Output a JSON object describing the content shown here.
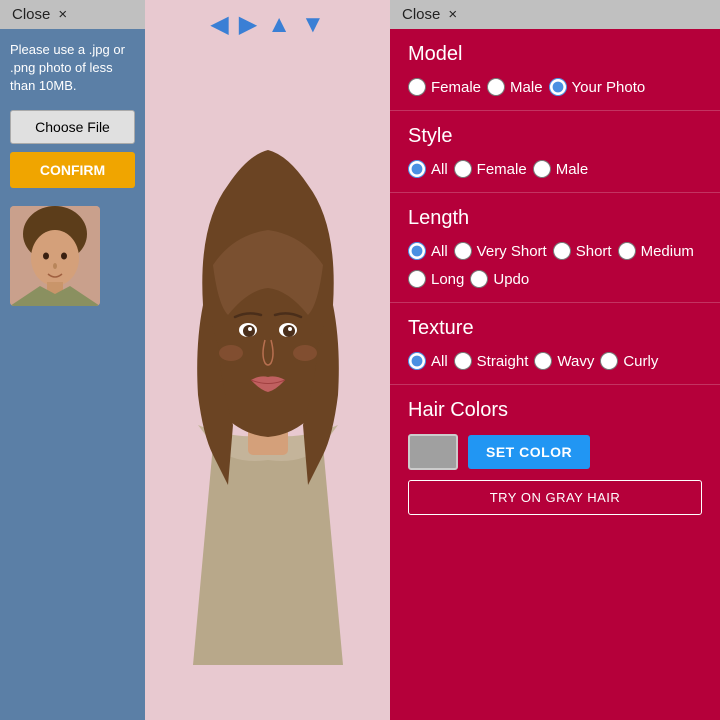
{
  "sidebar": {
    "close_label": "Close",
    "close_icon": "×",
    "instruction": "Please use a .jpg or .png photo of less than 10MB.",
    "choose_file_label": "Choose File",
    "confirm_label": "CONFIRM"
  },
  "nav": {
    "left_arrow": "←",
    "right_arrow": "→",
    "up_arrow": "↑",
    "down_arrow": "↓"
  },
  "panel": {
    "close_label": "Close",
    "close_icon": "×"
  },
  "model": {
    "title": "Model",
    "options": [
      "Female",
      "Male",
      "Your Photo"
    ],
    "selected": "Your Photo"
  },
  "style": {
    "title": "Style",
    "options": [
      "All",
      "Female",
      "Male"
    ],
    "selected": "All"
  },
  "length": {
    "title": "Length",
    "options_row1": [
      "All",
      "Very Short",
      "Short"
    ],
    "options_row2": [
      "Medium",
      "Long",
      "Updo"
    ],
    "selected": "All"
  },
  "texture": {
    "title": "Texture",
    "options_row1": [
      "All",
      "Straight",
      "Wavy"
    ],
    "options_row2": [
      "Curly"
    ],
    "selected": "All"
  },
  "hair_colors": {
    "title": "Hair Colors",
    "set_color_label": "SET COLOR",
    "try_gray_label": "TRY ON GRAY HAIR"
  }
}
